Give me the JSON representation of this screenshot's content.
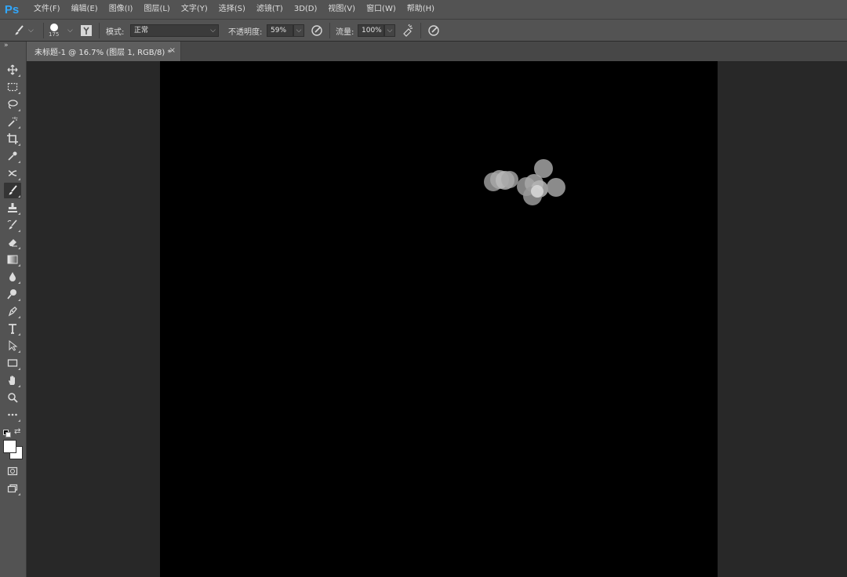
{
  "app": {
    "logo": "Ps"
  },
  "menu": [
    "文件(F)",
    "编辑(E)",
    "图像(I)",
    "图层(L)",
    "文字(Y)",
    "选择(S)",
    "滤镜(T)",
    "3D(D)",
    "视图(V)",
    "窗口(W)",
    "帮助(H)"
  ],
  "options": {
    "brush_size": "175",
    "mode_label": "模式:",
    "mode_value": "正常",
    "opacity_label": "不透明度:",
    "opacity_value": "59%",
    "flow_label": "流量:",
    "flow_value": "100%"
  },
  "document": {
    "tab_title": "未标题-1 @ 16.7% (图层 1, RGB/8) *",
    "close_glyph": "×"
  },
  "toolbar": {
    "collapse_glyph": "»",
    "tools": [
      "move-tool",
      "marquee-tool",
      "lasso-tool",
      "magic-wand-tool",
      "crop-tool",
      "eyedropper-tool",
      "healing-brush-tool",
      "brush-tool",
      "clone-stamp-tool",
      "history-brush-tool",
      "eraser-tool",
      "gradient-tool",
      "blur-tool",
      "dodge-tool",
      "pen-tool",
      "type-tool",
      "path-selection-tool",
      "rectangle-tool",
      "hand-tool",
      "zoom-tool",
      "more-tools"
    ],
    "active_tool": "brush-tool",
    "foreground_color": "#ffffff",
    "background_color": "#ffffff"
  },
  "colors": {
    "canvas": "#000000",
    "bokeh": [
      "#9a9a9a",
      "#a8a8a8",
      "#d8d8d8"
    ]
  }
}
